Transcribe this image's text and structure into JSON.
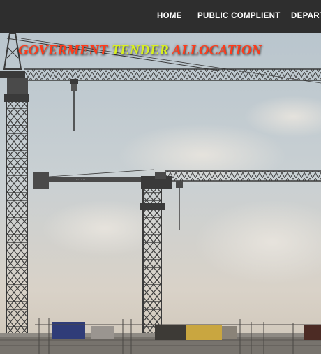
{
  "nav": {
    "items": [
      "HOME",
      "PUBLIC COMPLIENT",
      "DEPART"
    ]
  },
  "hero": {
    "title_parts": [
      "GOVERMENT",
      "TENDER",
      "ALLOCATION"
    ]
  },
  "colors": {
    "navbar": "#2e2e2e",
    "title_red": "#ff3a1a",
    "title_yellow": "#d8f020",
    "crane": "#3a3a3a"
  }
}
